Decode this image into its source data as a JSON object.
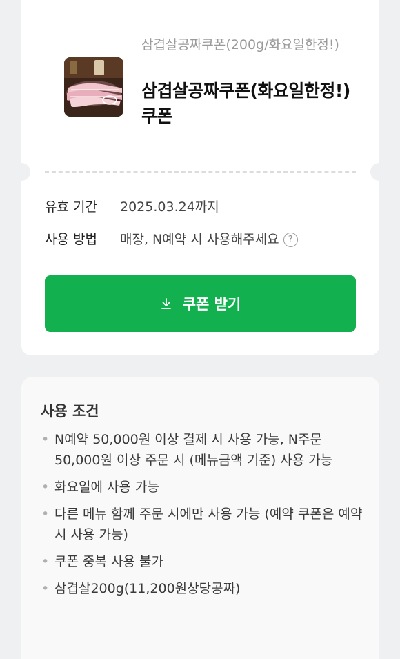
{
  "coupon": {
    "thumbnail_name": "samgyeopsal-photo",
    "subtitle": "삼겹살공짜쿠폰(200g/화요일한정!)",
    "title": "삼겹살공짜쿠폰(화요일한정!) 쿠폰",
    "validity_label": "유효 기간",
    "validity_value": "2025.03.24까지",
    "usage_label": "사용 방법",
    "usage_value": "매장, N예약 시 사용해주세요",
    "help_icon": "question-circle-icon",
    "download_icon": "download-icon",
    "download_label": "쿠폰 받기"
  },
  "conditions": {
    "heading": "사용 조건",
    "items": [
      "N예약 50,000원 이상 결제 시 사용 가능, N주문 50,000원 이상 주문 시 (메뉴금액 기준) 사용 가능",
      "화요일에 사용 가능",
      "다른 메뉴 함께 주문 시에만 사용 가능 (예약 쿠폰은 예약시 사용 가능)",
      "쿠폰 중복 사용 불가",
      "삼겹살200g(11,200원상당공짜)"
    ]
  },
  "colors": {
    "background": "#eff0f2",
    "button": "#12b04e",
    "card": "#ffffff",
    "conditions_card": "#f9f9f9"
  }
}
